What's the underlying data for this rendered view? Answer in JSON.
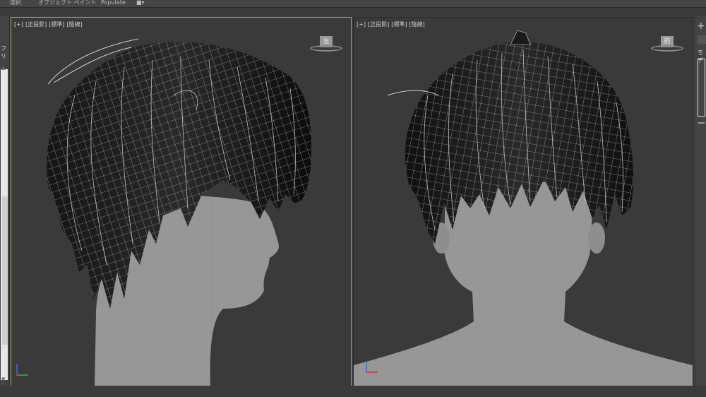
{
  "menu": {
    "item_select": "選択",
    "item_object_paint": "オブジェクト ペイント",
    "item_populate": "Populate"
  },
  "viewports": {
    "left": {
      "label_plus": "[+]",
      "label_projection": "[正投影]",
      "label_shading": "[標準]",
      "label_edges": "[陰線]",
      "cube_face": "左"
    },
    "front": {
      "label_plus": "[+]",
      "label_projection": "[正投影]",
      "label_shading": "[標準]",
      "label_edges": "[陰線]",
      "cube_face": "前"
    }
  },
  "left_panel": {
    "label": "フリ"
  },
  "right_panel": {
    "label": "モデ"
  },
  "colors": {
    "active_border": "#b8a058",
    "viewport_bg": "#3a3a3a",
    "mesh_fill": "#969696",
    "hair_dark": "#0e0e0e",
    "wire": "#d0d0d0"
  }
}
